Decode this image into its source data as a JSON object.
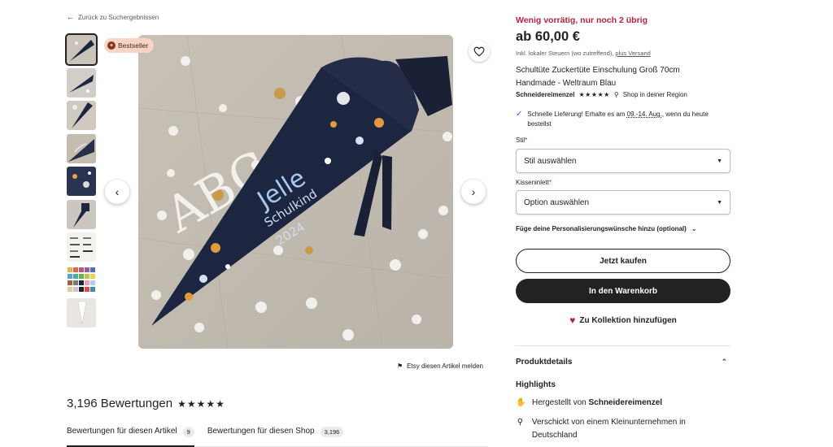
{
  "nav": {
    "back_label": "Zurück zu Suchergebnissen"
  },
  "gallery": {
    "badge": "Bestseller",
    "thumb_count": 9,
    "image_texts": {
      "letters": "ABC",
      "name": "Jelle",
      "line2": "Schulkind",
      "line3": "2024"
    },
    "report_label": "Etsy diesen Artikel melden"
  },
  "reviews": {
    "count": "3,196 Bewertungen",
    "stars": "★★★★★",
    "tabs": [
      {
        "label": "Bewertungen für diesen Artikel",
        "count": "9"
      },
      {
        "label": "Bewertungen für diesen Shop",
        "count": "3,196"
      }
    ]
  },
  "product": {
    "stock": "Wenig vorrätig, nur noch 2 übrig",
    "price": "ab 60,00 €",
    "tax_text": "Inkl. lokaler Steuern (wo zutreffend), ",
    "shipping_link": "plus Versand",
    "title": "Schultüte Zuckertüte Einschulung Groß 70cm Handmade - Weltraum Blau",
    "shop_name": "Schneidereimenzel",
    "shop_stars": "★★★★★",
    "shop_location": "Shop in deiner Region",
    "delivery_prefix": "Schnelle Lieferung! Erhalte es am ",
    "delivery_dates": "09.-14. Aug.",
    "delivery_suffix": ", wenn du heute bestellst"
  },
  "options": {
    "style_label": "Stil",
    "style_value": "Stil auswählen",
    "cushion_label": "Kisseninlett",
    "cushion_value": "Option auswählen",
    "personalize_label": "Füge deine Personalisierungswünsche hinzu (optional)"
  },
  "actions": {
    "buy_now": "Jetzt kaufen",
    "add_to_cart": "In den Warenkorb",
    "add_collection": "Zu Kollektion hinzufügen"
  },
  "details": {
    "heading": "Produktdetails",
    "highlights_heading": "Highlights",
    "made_by_prefix": "Hergestellt von ",
    "made_by_shop": "Schneidereimenzel",
    "shipped_from": "Verschickt von einem Kleinunternehmen in Deutschland"
  },
  "colors": {
    "accent_red": "#b7223d",
    "navy": "#1d2640",
    "button_dark": "#222222",
    "badge_bg": "#fbd3c3"
  }
}
